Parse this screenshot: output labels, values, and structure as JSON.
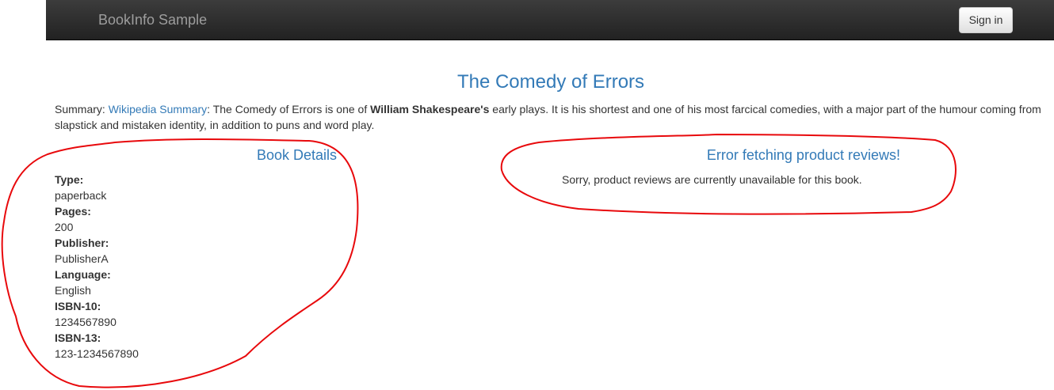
{
  "navbar": {
    "brand": "BookInfo Sample",
    "signin_label": "Sign in"
  },
  "book": {
    "title": "The Comedy of Errors",
    "summary_label": "Summary:",
    "summary_link": "Wikipedia Summary",
    "summary_part1": ": The Comedy of Errors is one of ",
    "summary_bold": "William Shakespeare's",
    "summary_part2": " early plays. It is his shortest and one of his most farcical comedies, with a major part of the humour coming from slapstick and mistaken identity, in addition to puns and word play."
  },
  "details": {
    "heading": "Book Details",
    "items": [
      {
        "label": "Type:",
        "value": "paperback"
      },
      {
        "label": "Pages:",
        "value": "200"
      },
      {
        "label": "Publisher:",
        "value": "PublisherA"
      },
      {
        "label": "Language:",
        "value": "English"
      },
      {
        "label": "ISBN-10:",
        "value": "1234567890"
      },
      {
        "label": "ISBN-13:",
        "value": "123-1234567890"
      }
    ]
  },
  "reviews": {
    "heading": "Error fetching product reviews!",
    "message": "Sorry, product reviews are currently unavailable for this book."
  },
  "colors": {
    "navbar_bg": "#222222",
    "brand_text": "#9d9d9d",
    "link_blue": "#337ab7",
    "annotation_red": "#e8090c"
  }
}
